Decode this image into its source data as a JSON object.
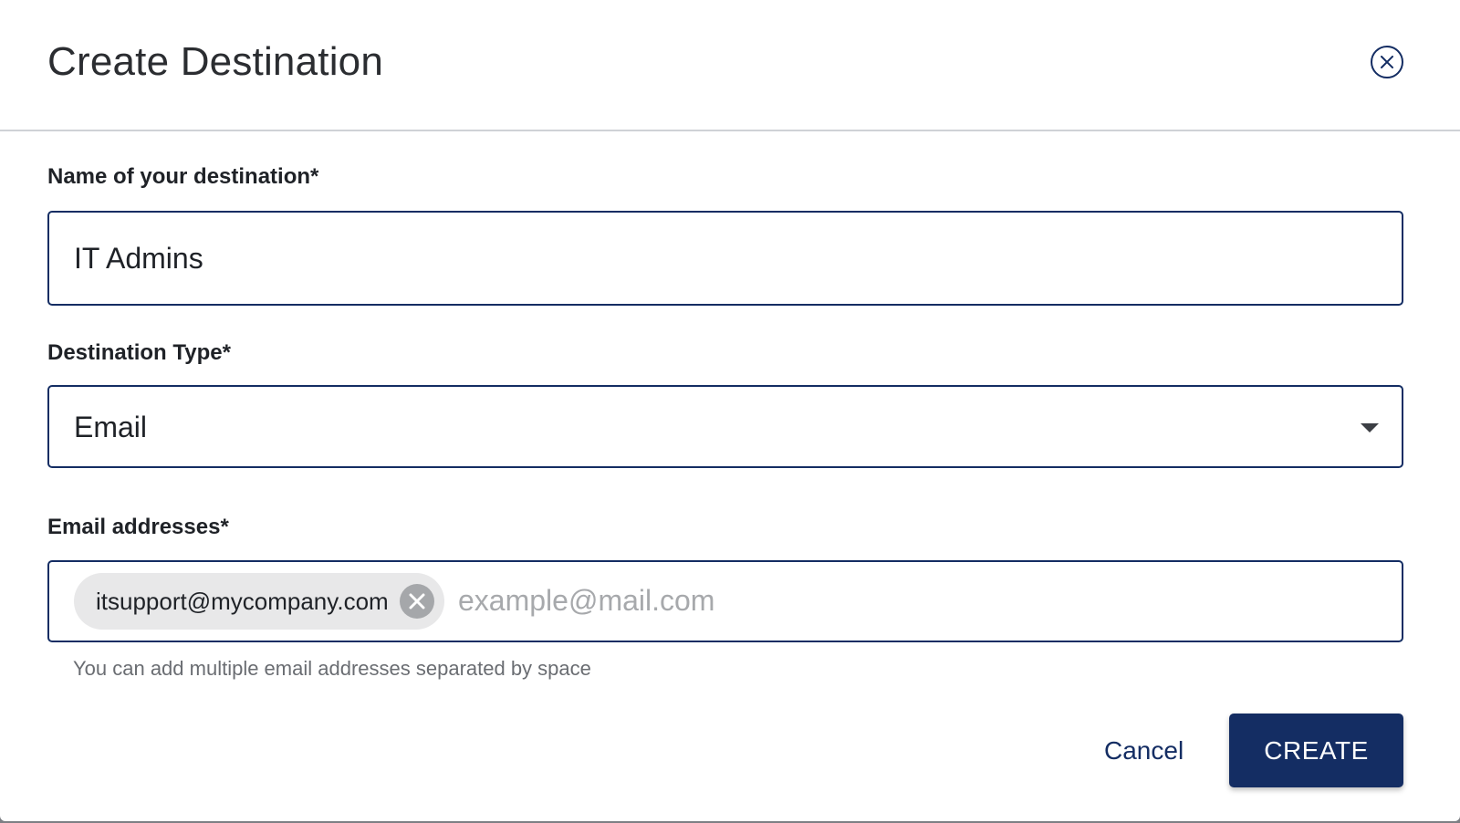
{
  "dialog": {
    "title": "Create Destination",
    "close_icon": "close-circle-icon"
  },
  "form": {
    "name_field": {
      "label": "Name of your destination*",
      "value": "IT Admins"
    },
    "type_field": {
      "label": "Destination Type*",
      "selected": "Email",
      "arrow_icon": "caret-down-icon"
    },
    "email_field": {
      "label": "Email addresses*",
      "chips": [
        {
          "label": "itsupport@mycompany.com",
          "remove_icon": "remove-circle-icon"
        }
      ],
      "placeholder": "example@mail.com",
      "helper": "You can add multiple email addresses separated by space"
    }
  },
  "actions": {
    "cancel_label": "Cancel",
    "create_label": "CREATE"
  },
  "colors": {
    "primary": "#142d63",
    "chip_bg": "#e8e8e9",
    "chip_remove_bg": "#a5a7aa",
    "placeholder": "#a7a9ac",
    "helper_text": "#6a6d72",
    "divider": "#cfd2d6"
  }
}
